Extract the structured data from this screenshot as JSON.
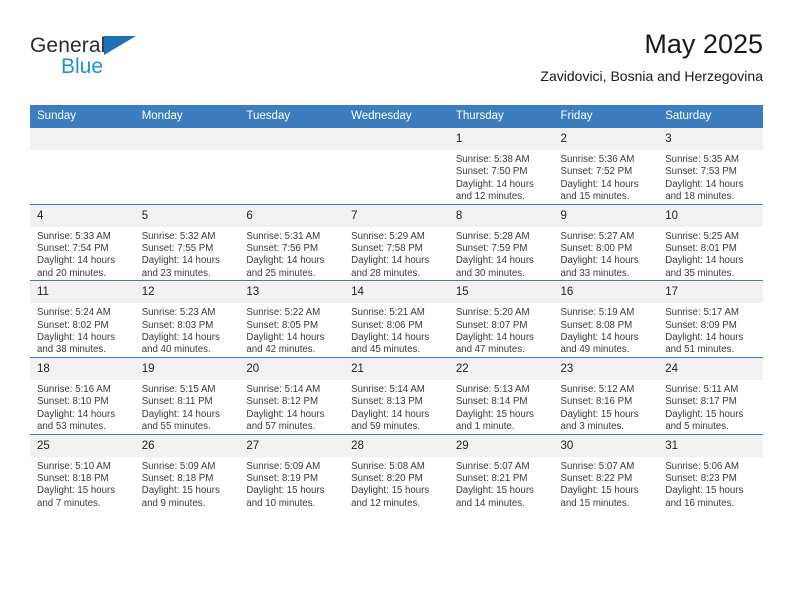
{
  "brand": {
    "name_top": "General",
    "name_bottom": "Blue",
    "color_dark": "#2b2b2b",
    "color_blue": "#1f8fd6",
    "triangle_color": "#1f71b8"
  },
  "header": {
    "title": "May 2025",
    "subtitle": "Zavidovici, Bosnia and Herzegovina"
  },
  "theme": {
    "header_bg": "#3b7dbf",
    "header_text": "#ffffff",
    "daynum_bg": "#f1f1f1",
    "cell_bg": "#ffffff",
    "rule_color": "#3b7dbf"
  },
  "weekdays": [
    "Sunday",
    "Monday",
    "Tuesday",
    "Wednesday",
    "Thursday",
    "Friday",
    "Saturday"
  ],
  "weeks": [
    [
      {
        "day": "",
        "sunrise": "",
        "sunset": "",
        "daylight": "",
        "daylight_cont": ""
      },
      {
        "day": "",
        "sunrise": "",
        "sunset": "",
        "daylight": "",
        "daylight_cont": ""
      },
      {
        "day": "",
        "sunrise": "",
        "sunset": "",
        "daylight": "",
        "daylight_cont": ""
      },
      {
        "day": "",
        "sunrise": "",
        "sunset": "",
        "daylight": "",
        "daylight_cont": ""
      },
      {
        "day": "1",
        "sunrise": "Sunrise: 5:38 AM",
        "sunset": "Sunset: 7:50 PM",
        "daylight": "Daylight: 14 hours",
        "daylight_cont": "and 12 minutes."
      },
      {
        "day": "2",
        "sunrise": "Sunrise: 5:36 AM",
        "sunset": "Sunset: 7:52 PM",
        "daylight": "Daylight: 14 hours",
        "daylight_cont": "and 15 minutes."
      },
      {
        "day": "3",
        "sunrise": "Sunrise: 5:35 AM",
        "sunset": "Sunset: 7:53 PM",
        "daylight": "Daylight: 14 hours",
        "daylight_cont": "and 18 minutes."
      }
    ],
    [
      {
        "day": "4",
        "sunrise": "Sunrise: 5:33 AM",
        "sunset": "Sunset: 7:54 PM",
        "daylight": "Daylight: 14 hours",
        "daylight_cont": "and 20 minutes."
      },
      {
        "day": "5",
        "sunrise": "Sunrise: 5:32 AM",
        "sunset": "Sunset: 7:55 PM",
        "daylight": "Daylight: 14 hours",
        "daylight_cont": "and 23 minutes."
      },
      {
        "day": "6",
        "sunrise": "Sunrise: 5:31 AM",
        "sunset": "Sunset: 7:56 PM",
        "daylight": "Daylight: 14 hours",
        "daylight_cont": "and 25 minutes."
      },
      {
        "day": "7",
        "sunrise": "Sunrise: 5:29 AM",
        "sunset": "Sunset: 7:58 PM",
        "daylight": "Daylight: 14 hours",
        "daylight_cont": "and 28 minutes."
      },
      {
        "day": "8",
        "sunrise": "Sunrise: 5:28 AM",
        "sunset": "Sunset: 7:59 PM",
        "daylight": "Daylight: 14 hours",
        "daylight_cont": "and 30 minutes."
      },
      {
        "day": "9",
        "sunrise": "Sunrise: 5:27 AM",
        "sunset": "Sunset: 8:00 PM",
        "daylight": "Daylight: 14 hours",
        "daylight_cont": "and 33 minutes."
      },
      {
        "day": "10",
        "sunrise": "Sunrise: 5:25 AM",
        "sunset": "Sunset: 8:01 PM",
        "daylight": "Daylight: 14 hours",
        "daylight_cont": "and 35 minutes."
      }
    ],
    [
      {
        "day": "11",
        "sunrise": "Sunrise: 5:24 AM",
        "sunset": "Sunset: 8:02 PM",
        "daylight": "Daylight: 14 hours",
        "daylight_cont": "and 38 minutes."
      },
      {
        "day": "12",
        "sunrise": "Sunrise: 5:23 AM",
        "sunset": "Sunset: 8:03 PM",
        "daylight": "Daylight: 14 hours",
        "daylight_cont": "and 40 minutes."
      },
      {
        "day": "13",
        "sunrise": "Sunrise: 5:22 AM",
        "sunset": "Sunset: 8:05 PM",
        "daylight": "Daylight: 14 hours",
        "daylight_cont": "and 42 minutes."
      },
      {
        "day": "14",
        "sunrise": "Sunrise: 5:21 AM",
        "sunset": "Sunset: 8:06 PM",
        "daylight": "Daylight: 14 hours",
        "daylight_cont": "and 45 minutes."
      },
      {
        "day": "15",
        "sunrise": "Sunrise: 5:20 AM",
        "sunset": "Sunset: 8:07 PM",
        "daylight": "Daylight: 14 hours",
        "daylight_cont": "and 47 minutes."
      },
      {
        "day": "16",
        "sunrise": "Sunrise: 5:19 AM",
        "sunset": "Sunset: 8:08 PM",
        "daylight": "Daylight: 14 hours",
        "daylight_cont": "and 49 minutes."
      },
      {
        "day": "17",
        "sunrise": "Sunrise: 5:17 AM",
        "sunset": "Sunset: 8:09 PM",
        "daylight": "Daylight: 14 hours",
        "daylight_cont": "and 51 minutes."
      }
    ],
    [
      {
        "day": "18",
        "sunrise": "Sunrise: 5:16 AM",
        "sunset": "Sunset: 8:10 PM",
        "daylight": "Daylight: 14 hours",
        "daylight_cont": "and 53 minutes."
      },
      {
        "day": "19",
        "sunrise": "Sunrise: 5:15 AM",
        "sunset": "Sunset: 8:11 PM",
        "daylight": "Daylight: 14 hours",
        "daylight_cont": "and 55 minutes."
      },
      {
        "day": "20",
        "sunrise": "Sunrise: 5:14 AM",
        "sunset": "Sunset: 8:12 PM",
        "daylight": "Daylight: 14 hours",
        "daylight_cont": "and 57 minutes."
      },
      {
        "day": "21",
        "sunrise": "Sunrise: 5:14 AM",
        "sunset": "Sunset: 8:13 PM",
        "daylight": "Daylight: 14 hours",
        "daylight_cont": "and 59 minutes."
      },
      {
        "day": "22",
        "sunrise": "Sunrise: 5:13 AM",
        "sunset": "Sunset: 8:14 PM",
        "daylight": "Daylight: 15 hours",
        "daylight_cont": "and 1 minute."
      },
      {
        "day": "23",
        "sunrise": "Sunrise: 5:12 AM",
        "sunset": "Sunset: 8:16 PM",
        "daylight": "Daylight: 15 hours",
        "daylight_cont": "and 3 minutes."
      },
      {
        "day": "24",
        "sunrise": "Sunrise: 5:11 AM",
        "sunset": "Sunset: 8:17 PM",
        "daylight": "Daylight: 15 hours",
        "daylight_cont": "and 5 minutes."
      }
    ],
    [
      {
        "day": "25",
        "sunrise": "Sunrise: 5:10 AM",
        "sunset": "Sunset: 8:18 PM",
        "daylight": "Daylight: 15 hours",
        "daylight_cont": "and 7 minutes."
      },
      {
        "day": "26",
        "sunrise": "Sunrise: 5:09 AM",
        "sunset": "Sunset: 8:18 PM",
        "daylight": "Daylight: 15 hours",
        "daylight_cont": "and 9 minutes."
      },
      {
        "day": "27",
        "sunrise": "Sunrise: 5:09 AM",
        "sunset": "Sunset: 8:19 PM",
        "daylight": "Daylight: 15 hours",
        "daylight_cont": "and 10 minutes."
      },
      {
        "day": "28",
        "sunrise": "Sunrise: 5:08 AM",
        "sunset": "Sunset: 8:20 PM",
        "daylight": "Daylight: 15 hours",
        "daylight_cont": "and 12 minutes."
      },
      {
        "day": "29",
        "sunrise": "Sunrise: 5:07 AM",
        "sunset": "Sunset: 8:21 PM",
        "daylight": "Daylight: 15 hours",
        "daylight_cont": "and 14 minutes."
      },
      {
        "day": "30",
        "sunrise": "Sunrise: 5:07 AM",
        "sunset": "Sunset: 8:22 PM",
        "daylight": "Daylight: 15 hours",
        "daylight_cont": "and 15 minutes."
      },
      {
        "day": "31",
        "sunrise": "Sunrise: 5:06 AM",
        "sunset": "Sunset: 8:23 PM",
        "daylight": "Daylight: 15 hours",
        "daylight_cont": "and 16 minutes."
      }
    ]
  ]
}
